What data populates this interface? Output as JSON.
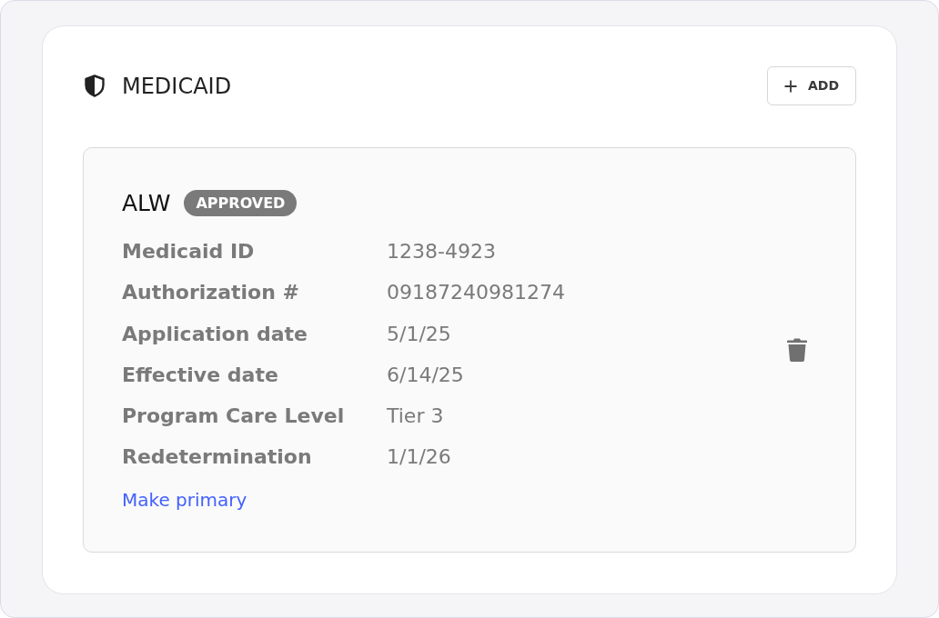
{
  "section": {
    "title": "MEDICAID",
    "add_button": "ADD"
  },
  "cards": [
    {
      "program": "ALW",
      "status": "APPROVED",
      "fields": [
        {
          "label": "Medicaid ID",
          "value": "1238-4923"
        },
        {
          "label": "Authorization #",
          "value": "09187240981274"
        },
        {
          "label": "Application date",
          "value": "5/1/25"
        },
        {
          "label": "Effective date",
          "value": "6/14/25"
        },
        {
          "label": "Program Care Level",
          "value": "Tier 3"
        },
        {
          "label": "Redetermination",
          "value": "1/1/26"
        }
      ],
      "link": "Make primary"
    }
  ]
}
